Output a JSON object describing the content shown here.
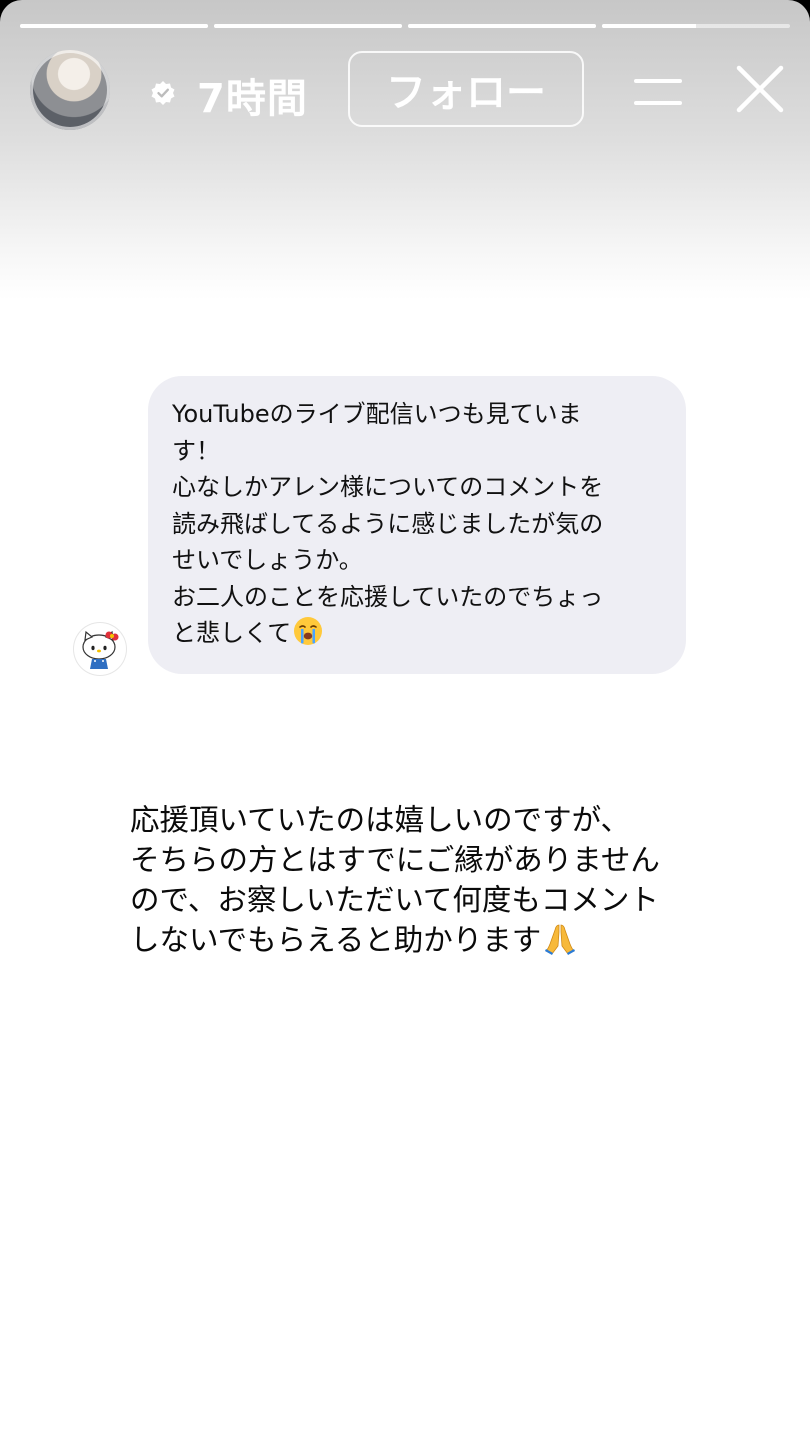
{
  "story": {
    "progress_segments": [
      {
        "progress": 1.0
      },
      {
        "progress": 1.0
      },
      {
        "progress": 1.0
      },
      {
        "progress": 0.5
      }
    ],
    "header": {
      "time": "7時間",
      "follow_label": "フォロー",
      "icons": [
        "avatar",
        "verified-badge-icon",
        "menu-icon",
        "close-icon"
      ]
    },
    "question": {
      "avatar_icon": "hello-kitty-avatar",
      "lines": [
        "YouTubeのライブ配信いつも見ていま",
        "す！",
        "心なしかアレン様についてのコメントを",
        "読み飛ばしてるように感じましたが気の",
        "せいでしょうか。",
        "お二人のことを応援していたのでちょっ",
        "と悲しくて"
      ],
      "trailing_emoji": "crying-face-emoji",
      "bubble_color": "#eeeef4"
    },
    "answer": {
      "lines": [
        "応援頂いていたのは嬉しいのですが、",
        "そちらの方とはすでにご縁がありません",
        "ので、お察しいただいて何度もコメント",
        "しないでもらえると助かります"
      ],
      "trailing_emoji": "folded-hands-emoji"
    }
  }
}
